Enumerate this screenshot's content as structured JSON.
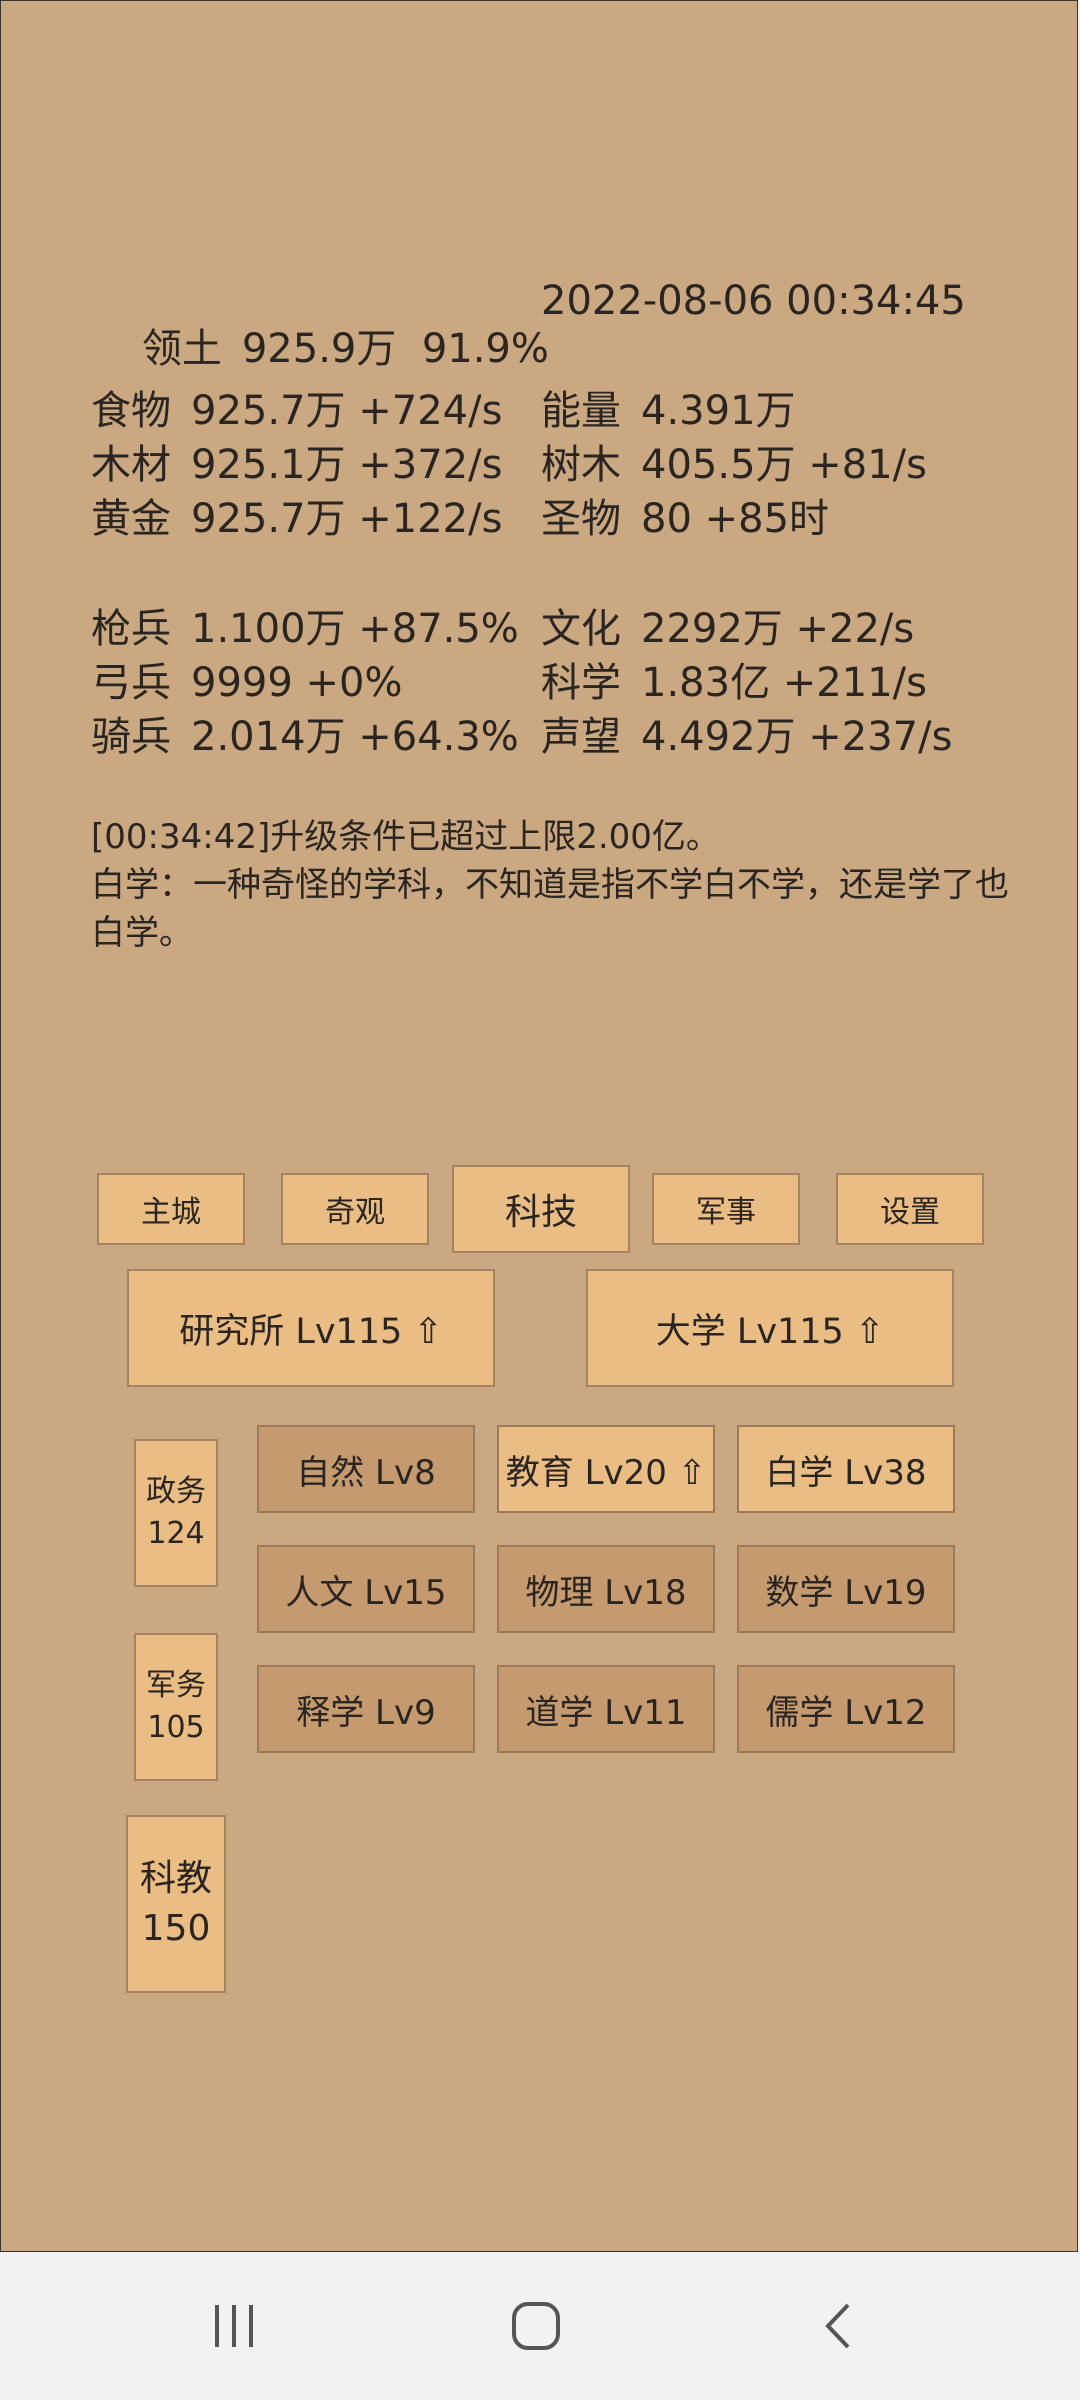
{
  "territory": {
    "label": "领土",
    "value": "925.9万",
    "percent": "91.9%",
    "datetime": "2022-08-06 00:34:45"
  },
  "resources_left": [
    {
      "label": "食物",
      "value": "925.7万 +724/s"
    },
    {
      "label": "木材",
      "value": "925.1万 +372/s"
    },
    {
      "label": "黄金",
      "value": "925.7万 +122/s"
    }
  ],
  "resources_right": [
    {
      "label": "能量",
      "value": "4.391万"
    },
    {
      "label": "树木",
      "value": "405.5万 +81/s"
    },
    {
      "label": "圣物",
      "value": "80 +85时"
    }
  ],
  "military_left": [
    {
      "label": "枪兵",
      "value": "1.100万 +87.5%"
    },
    {
      "label": "弓兵",
      "value": "9999 +0%"
    },
    {
      "label": "骑兵",
      "value": "2.014万 +64.3%"
    }
  ],
  "military_right": [
    {
      "label": "文化",
      "value": "2292万 +22/s"
    },
    {
      "label": "科学",
      "value": "1.83亿 +211/s"
    },
    {
      "label": "声望",
      "value": "4.492万 +237/s"
    }
  ],
  "log": {
    "line1": "[00:34:42]升级条件已超过上限2.00亿。",
    "line2": "白学：一种奇怪的学科，不知道是指不学白不学，还是学了也白学。"
  },
  "tabs": [
    "主城",
    "奇观",
    "科技",
    "军事",
    "设置"
  ],
  "active_tab": "科技",
  "buildings": [
    "研究所 Lv115 ⇧",
    "大学 Lv115 ⇧"
  ],
  "categories": [
    {
      "name": "政务",
      "count": "124"
    },
    {
      "name": "军务",
      "count": "105"
    },
    {
      "name": "科教",
      "count": "150"
    }
  ],
  "techs": [
    [
      "自然 Lv8",
      "教育 Lv20 ⇧",
      "白学 Lv38"
    ],
    [
      "人文 Lv15",
      "物理 Lv18",
      "数学 Lv19"
    ],
    [
      "释学 Lv9",
      "道学 Lv11",
      "儒学 Lv12"
    ]
  ],
  "colors": {
    "panel": "#c9a882",
    "button": "#e9bd84",
    "button_dim": "#c59a6e"
  },
  "nav_icons": [
    "recent-apps-icon",
    "home-icon",
    "back-icon"
  ]
}
